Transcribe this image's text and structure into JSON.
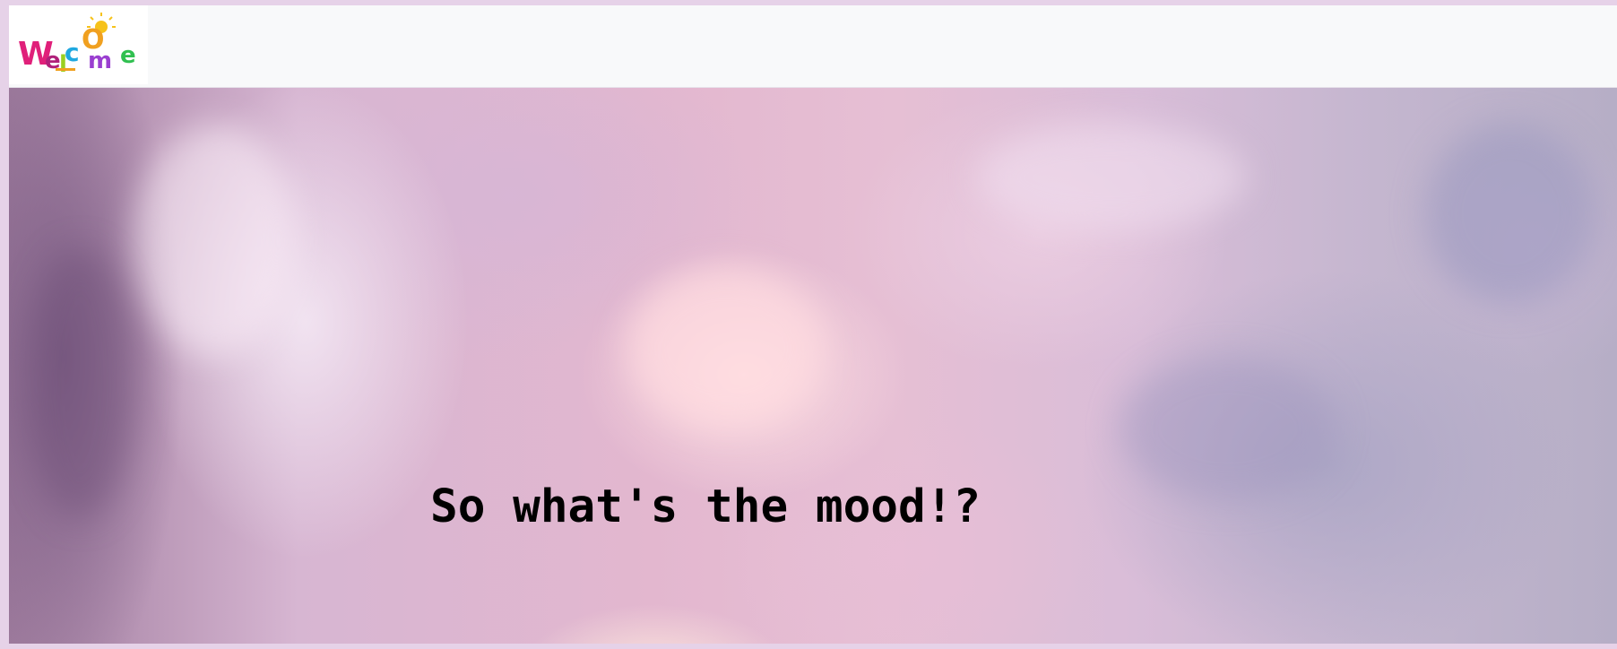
{
  "navbar": {
    "logo": {
      "icon": "welcome-logo",
      "text": "Welcome",
      "colors": [
        "#e0207a",
        "#9a3fd0",
        "#f0a020",
        "#1fa8e0",
        "#9ad020",
        "#30c050"
      ]
    }
  },
  "hero": {
    "headline": "So what's the mood!?",
    "background": "pink-purple-clouds"
  }
}
